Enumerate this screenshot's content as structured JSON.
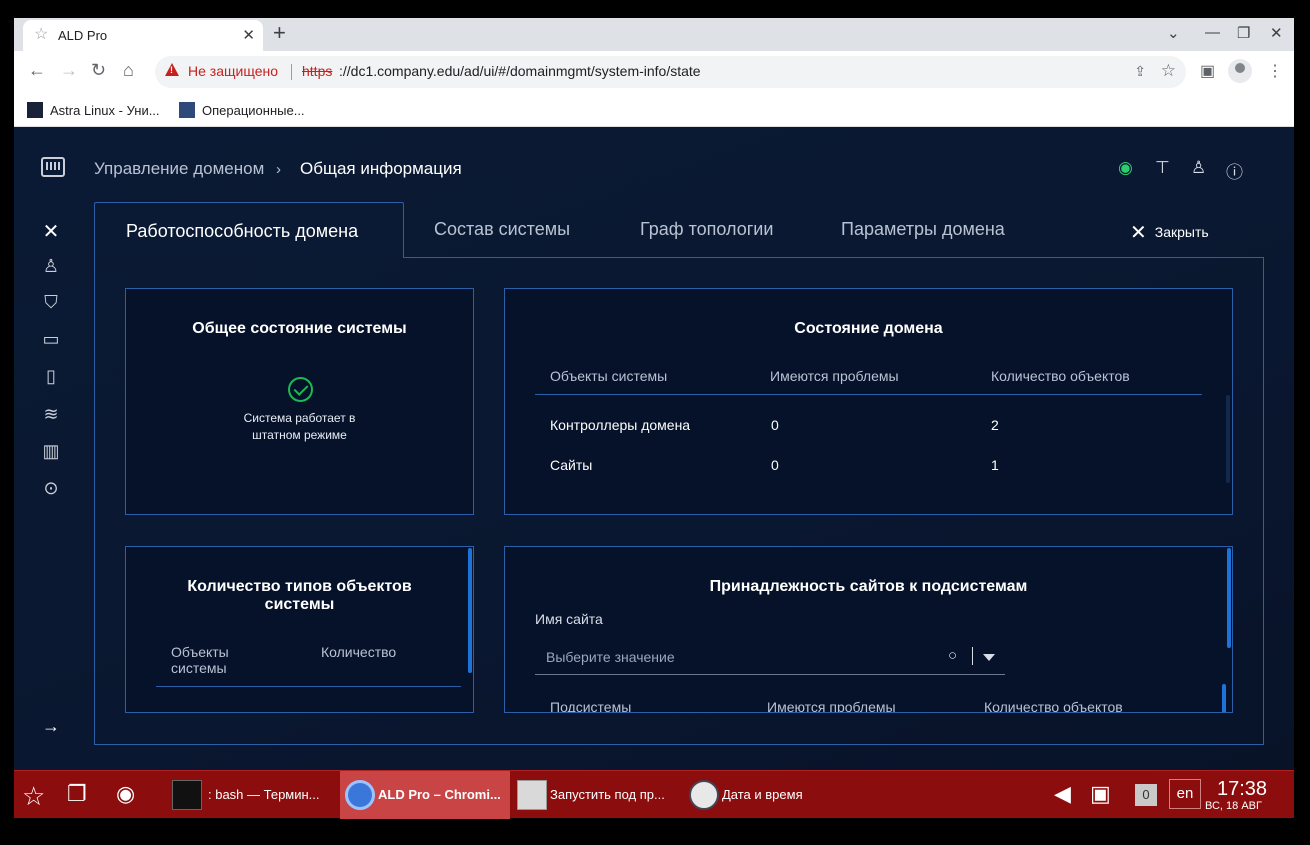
{
  "browser": {
    "tab_title": "ALD Pro",
    "new_tab": "+",
    "not_secure": "Не защищено",
    "url_scheme": "https",
    "url_rest": "://dc1.company.edu/ad/ui/#/domainmgmt/system-info/state",
    "bookmarks": [
      "Astra Linux - Уни...",
      "Операционные..."
    ]
  },
  "breadcrumb": {
    "root": "Управление доменом",
    "current": "Общая информация"
  },
  "tabs": [
    "Работоспособность домена",
    "Состав системы",
    "Граф топологии",
    "Параметры домена"
  ],
  "close_label": "Закрыть",
  "system_status": {
    "title": "Общее состояние системы",
    "line1": "Система работает в",
    "line2": "штатном режиме"
  },
  "domain_status": {
    "title": "Состояние домена",
    "headers": [
      "Объекты системы",
      "Имеются проблемы",
      "Количество объектов"
    ],
    "rows": [
      [
        "Контроллеры домена",
        "0",
        "2"
      ],
      [
        "Сайты",
        "0",
        "1"
      ]
    ]
  },
  "object_types": {
    "title1": "Количество типов объектов",
    "title2": "системы",
    "headers": [
      "Объекты системы",
      "Количество"
    ],
    "h1a": "Объекты",
    "h1b": "системы"
  },
  "site_membership": {
    "title": "Принадлежность сайтов к подсистемам",
    "site_label": "Имя сайта",
    "placeholder": "Выберите значение",
    "headers": [
      "Подсистемы",
      "Имеются проблемы",
      "Количество объектов"
    ]
  },
  "taskbar": {
    "items": [
      ": bash — Термин...",
      "ALD Pro – Chromi...",
      "Запустить под пр...",
      "Дата и время"
    ],
    "badge": "0",
    "lang": "en",
    "time": "17:38",
    "date": "ВС, 18 АВГ"
  }
}
